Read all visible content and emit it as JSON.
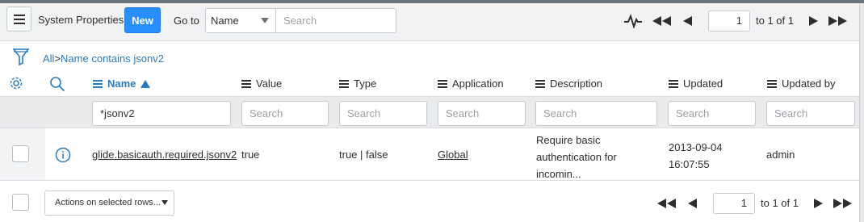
{
  "header": {
    "title": "System Properties",
    "new_label": "New",
    "goto_label": "Go to",
    "goto_field": "Name",
    "search_placeholder": "Search",
    "page_value": "1",
    "page_of": "to 1 of 1"
  },
  "breadcrumb": {
    "all": "All",
    "separator": ">",
    "condition": "Name contains jsonv2"
  },
  "columns": [
    {
      "label": "Name",
      "sorted": "ascending"
    },
    {
      "label": "Value"
    },
    {
      "label": "Type"
    },
    {
      "label": "Application"
    },
    {
      "label": "Description"
    },
    {
      "label": "Updated"
    },
    {
      "label": "Updated by"
    }
  ],
  "filters": {
    "name_value": "*jsonv2",
    "placeholder": "Search"
  },
  "rows": [
    {
      "name": "glide.basicauth.required.jsonv2",
      "value": "true",
      "type": "true | false",
      "application": "Global",
      "description_lines": [
        "Require basic",
        "authentication for",
        "incomin..."
      ],
      "updated_date": "2013-09-04",
      "updated_time": "16:07:55",
      "updated_by": "admin"
    }
  ],
  "footer": {
    "actions_label": "Actions on selected rows...",
    "page_value": "1",
    "page_of": "to 1 of 1"
  },
  "icons": {
    "menu": "hamburger-icon",
    "activity": "pulse-icon",
    "first": "first-page-icon",
    "prev": "previous-page-icon",
    "next": "next-page-icon",
    "last": "last-page-icon",
    "filter": "funnel-icon",
    "settings": "gear-icon",
    "search": "magnifier-icon",
    "info": "info-icon"
  },
  "colors": {
    "accent": "#278efc",
    "link": "#2a7bbd",
    "header_bg": "#f1f2f3"
  }
}
